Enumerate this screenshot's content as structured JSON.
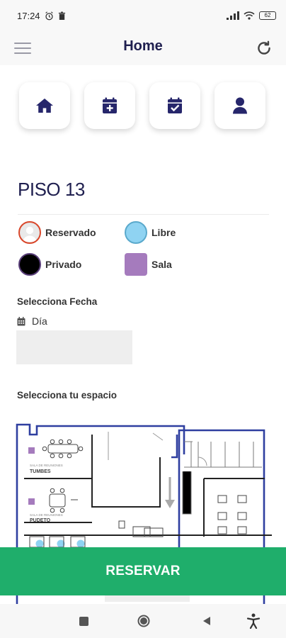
{
  "status_bar": {
    "time": "17:24",
    "battery": "62",
    "icons": [
      "alarm-icon",
      "trash-icon",
      "signal-icon",
      "wifi-icon",
      "battery-icon"
    ]
  },
  "header": {
    "title": "Home",
    "menu_icon": "hamburger-menu-icon",
    "refresh_icon": "refresh-icon"
  },
  "quick_actions": [
    {
      "icon": "home-icon"
    },
    {
      "icon": "calendar-plus-icon"
    },
    {
      "icon": "calendar-check-icon"
    },
    {
      "icon": "user-icon"
    }
  ],
  "floor": {
    "title": "PISO 13"
  },
  "legend": [
    {
      "label": "Reservado",
      "color": "#e0e0e0",
      "border": "#d9472b"
    },
    {
      "label": "Libre",
      "color": "#8fd3f2",
      "border": "#5aa9cc"
    },
    {
      "label": "Privado",
      "color": "#000000",
      "border": "#5a3f7a"
    },
    {
      "label": "Sala",
      "color": "#a57bbd",
      "border": "#a57bbd"
    }
  ],
  "date": {
    "section_label": "Selecciona Fecha",
    "day_label": "Día",
    "value": ""
  },
  "space": {
    "section_label": "Selecciona tu espacio"
  },
  "floor_plan": {
    "room_1": {
      "caption": "SALA DE REUNIONES",
      "name": "TUMBES"
    },
    "room_2": {
      "caption": "SALA DE REUNIONES",
      "name": "PUDETO"
    },
    "colors": {
      "wall": "#2f3fa0",
      "sala": "#a57bbd",
      "libre": "#8fd3f2"
    }
  },
  "actions": {
    "reserve_label": "RESERVAR",
    "color": "#1fae6b"
  },
  "nav_bar": {
    "icons": [
      "square-icon",
      "circle-icon",
      "back-triangle-icon",
      "accessibility-icon"
    ]
  }
}
